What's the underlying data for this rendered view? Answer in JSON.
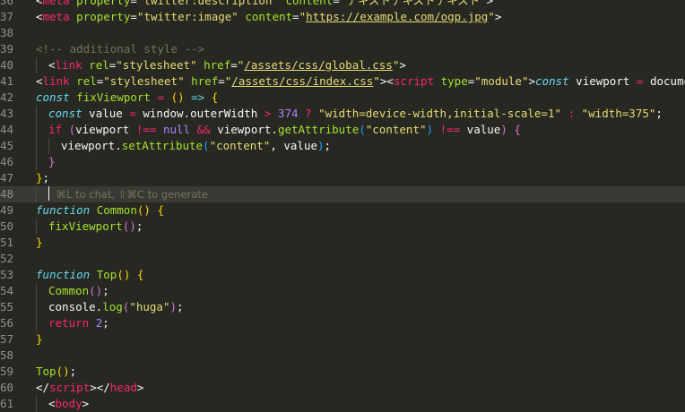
{
  "editor": {
    "lines": [
      {
        "num": "36",
        "parts": [
          {
            "t": "<",
            "c": "plain"
          },
          {
            "t": "meta",
            "c": "tag"
          },
          {
            "t": " ",
            "c": "plain"
          },
          {
            "t": "property",
            "c": "attr"
          },
          {
            "t": "=",
            "c": "plain"
          },
          {
            "t": "\"twitter:description\"",
            "c": "str"
          },
          {
            "t": " ",
            "c": "plain"
          },
          {
            "t": "content",
            "c": "attr"
          },
          {
            "t": "=",
            "c": "plain"
          },
          {
            "t": "\"テキストテキストテキスト\"",
            "c": "str"
          },
          {
            "t": ">",
            "c": "plain"
          }
        ]
      },
      {
        "num": "37",
        "parts": [
          {
            "t": "<",
            "c": "plain"
          },
          {
            "t": "meta",
            "c": "tag"
          },
          {
            "t": " ",
            "c": "plain"
          },
          {
            "t": "property",
            "c": "attr"
          },
          {
            "t": "=",
            "c": "plain"
          },
          {
            "t": "\"twitter:image\"",
            "c": "str"
          },
          {
            "t": " ",
            "c": "plain"
          },
          {
            "t": "content",
            "c": "attr"
          },
          {
            "t": "=",
            "c": "plain"
          },
          {
            "t": "\"",
            "c": "str"
          },
          {
            "t": "https://example.com/ogp.jpg",
            "c": "url"
          },
          {
            "t": "\"",
            "c": "str"
          },
          {
            "t": ">",
            "c": "plain"
          }
        ]
      },
      {
        "num": "38",
        "parts": []
      },
      {
        "num": "39",
        "parts": [
          {
            "t": "<!-- additional style -->",
            "c": "cmt"
          }
        ]
      },
      {
        "num": "40",
        "indent": 1,
        "parts": [
          {
            "t": "<",
            "c": "plain"
          },
          {
            "t": "link",
            "c": "tag"
          },
          {
            "t": " ",
            "c": "plain"
          },
          {
            "t": "rel",
            "c": "attr"
          },
          {
            "t": "=",
            "c": "plain"
          },
          {
            "t": "\"stylesheet\"",
            "c": "str"
          },
          {
            "t": " ",
            "c": "plain"
          },
          {
            "t": "href",
            "c": "attr"
          },
          {
            "t": "=",
            "c": "plain"
          },
          {
            "t": "\"",
            "c": "str"
          },
          {
            "t": "/assets/css/global.css",
            "c": "url"
          },
          {
            "t": "\"",
            "c": "str"
          },
          {
            "t": ">",
            "c": "plain"
          }
        ]
      },
      {
        "num": "41",
        "parts": [
          {
            "t": "<",
            "c": "plain"
          },
          {
            "t": "link",
            "c": "tag"
          },
          {
            "t": " ",
            "c": "plain"
          },
          {
            "t": "rel",
            "c": "attr"
          },
          {
            "t": "=",
            "c": "plain"
          },
          {
            "t": "\"stylesheet\"",
            "c": "str"
          },
          {
            "t": " ",
            "c": "plain"
          },
          {
            "t": "href",
            "c": "attr"
          },
          {
            "t": "=",
            "c": "plain"
          },
          {
            "t": "\"",
            "c": "str"
          },
          {
            "t": "/assets/css/index.css",
            "c": "url"
          },
          {
            "t": "\"",
            "c": "str"
          },
          {
            "t": "><",
            "c": "plain"
          },
          {
            "t": "script",
            "c": "tag"
          },
          {
            "t": " ",
            "c": "plain"
          },
          {
            "t": "type",
            "c": "attr"
          },
          {
            "t": "=",
            "c": "plain"
          },
          {
            "t": "\"module\"",
            "c": "str"
          },
          {
            "t": ">",
            "c": "plain"
          },
          {
            "t": "const",
            "c": "kw"
          },
          {
            "t": " viewport ",
            "c": "plain"
          },
          {
            "t": "=",
            "c": "op"
          },
          {
            "t": " document.",
            "c": "plain"
          }
        ]
      },
      {
        "num": "42",
        "parts": [
          {
            "t": "const",
            "c": "kw"
          },
          {
            "t": " ",
            "c": "plain"
          },
          {
            "t": "fixViewport",
            "c": "fn"
          },
          {
            "t": " ",
            "c": "plain"
          },
          {
            "t": "=",
            "c": "op"
          },
          {
            "t": " ",
            "c": "plain"
          },
          {
            "t": "()",
            "c": "brY"
          },
          {
            "t": " ",
            "c": "plain"
          },
          {
            "t": "=>",
            "c": "kw"
          },
          {
            "t": " ",
            "c": "plain"
          },
          {
            "t": "{",
            "c": "brY"
          }
        ]
      },
      {
        "num": "43",
        "indent": 1,
        "parts": [
          {
            "t": "const",
            "c": "kw"
          },
          {
            "t": " value ",
            "c": "plain"
          },
          {
            "t": "=",
            "c": "op"
          },
          {
            "t": " window.outerWidth ",
            "c": "plain"
          },
          {
            "t": ">",
            "c": "op"
          },
          {
            "t": " ",
            "c": "plain"
          },
          {
            "t": "374",
            "c": "num"
          },
          {
            "t": " ",
            "c": "plain"
          },
          {
            "t": "?",
            "c": "op"
          },
          {
            "t": " ",
            "c": "plain"
          },
          {
            "t": "\"width=device-width,initial-scale=1\"",
            "c": "str"
          },
          {
            "t": " ",
            "c": "plain"
          },
          {
            "t": ":",
            "c": "op"
          },
          {
            "t": " ",
            "c": "plain"
          },
          {
            "t": "\"width=375\"",
            "c": "str"
          },
          {
            "t": ";",
            "c": "plain"
          }
        ]
      },
      {
        "num": "44",
        "indent": 1,
        "parts": [
          {
            "t": "if",
            "c": "ctl"
          },
          {
            "t": " ",
            "c": "plain"
          },
          {
            "t": "(",
            "c": "brP"
          },
          {
            "t": "viewport ",
            "c": "plain"
          },
          {
            "t": "!==",
            "c": "op"
          },
          {
            "t": " ",
            "c": "plain"
          },
          {
            "t": "null",
            "c": "num"
          },
          {
            "t": " ",
            "c": "plain"
          },
          {
            "t": "&&",
            "c": "op"
          },
          {
            "t": " viewport.",
            "c": "plain"
          },
          {
            "t": "getAttribute",
            "c": "fn"
          },
          {
            "t": "(",
            "c": "brB"
          },
          {
            "t": "\"content\"",
            "c": "str"
          },
          {
            "t": ")",
            "c": "brB"
          },
          {
            "t": " ",
            "c": "plain"
          },
          {
            "t": "!==",
            "c": "op"
          },
          {
            "t": " value",
            "c": "plain"
          },
          {
            "t": ")",
            "c": "brP"
          },
          {
            "t": " ",
            "c": "plain"
          },
          {
            "t": "{",
            "c": "brP"
          }
        ]
      },
      {
        "num": "45",
        "indent": 2,
        "parts": [
          {
            "t": "viewport.",
            "c": "plain"
          },
          {
            "t": "setAttribute",
            "c": "fn"
          },
          {
            "t": "(",
            "c": "brB"
          },
          {
            "t": "\"content\"",
            "c": "str"
          },
          {
            "t": ", value",
            "c": "plain"
          },
          {
            "t": ")",
            "c": "brB"
          },
          {
            "t": ";",
            "c": "plain"
          }
        ]
      },
      {
        "num": "46",
        "indent": 1,
        "parts": [
          {
            "t": "}",
            "c": "brP"
          }
        ]
      },
      {
        "num": "47",
        "parts": [
          {
            "t": "}",
            "c": "brY"
          },
          {
            "t": ";",
            "c": "plain"
          }
        ]
      },
      {
        "num": "48",
        "active": true,
        "indent": 1,
        "cursor": true,
        "parts": [
          {
            "t": "⌘L to chat, ⇧⌘C to generate",
            "c": "hint"
          }
        ]
      },
      {
        "num": "49",
        "parts": [
          {
            "t": "function",
            "c": "kw"
          },
          {
            "t": " ",
            "c": "plain"
          },
          {
            "t": "Common",
            "c": "fn"
          },
          {
            "t": "()",
            "c": "brY"
          },
          {
            "t": " ",
            "c": "plain"
          },
          {
            "t": "{",
            "c": "brY"
          }
        ]
      },
      {
        "num": "50",
        "indent": 1,
        "parts": [
          {
            "t": "fixViewport",
            "c": "fn"
          },
          {
            "t": "()",
            "c": "brP"
          },
          {
            "t": ";",
            "c": "plain"
          }
        ]
      },
      {
        "num": "51",
        "parts": [
          {
            "t": "}",
            "c": "brY"
          }
        ]
      },
      {
        "num": "52",
        "parts": []
      },
      {
        "num": "53",
        "parts": [
          {
            "t": "function",
            "c": "kw"
          },
          {
            "t": " ",
            "c": "plain"
          },
          {
            "t": "Top",
            "c": "fn"
          },
          {
            "t": "()",
            "c": "brY"
          },
          {
            "t": " ",
            "c": "plain"
          },
          {
            "t": "{",
            "c": "brY"
          }
        ]
      },
      {
        "num": "54",
        "indent": 1,
        "parts": [
          {
            "t": "Common",
            "c": "fn"
          },
          {
            "t": "()",
            "c": "brP"
          },
          {
            "t": ";",
            "c": "plain"
          }
        ]
      },
      {
        "num": "55",
        "indent": 1,
        "parts": [
          {
            "t": "console.",
            "c": "plain"
          },
          {
            "t": "log",
            "c": "fn"
          },
          {
            "t": "(",
            "c": "brP"
          },
          {
            "t": "\"huga\"",
            "c": "str"
          },
          {
            "t": ")",
            "c": "brP"
          },
          {
            "t": ";",
            "c": "plain"
          }
        ]
      },
      {
        "num": "56",
        "indent": 1,
        "parts": [
          {
            "t": "return",
            "c": "ctl"
          },
          {
            "t": " ",
            "c": "plain"
          },
          {
            "t": "2",
            "c": "num"
          },
          {
            "t": ";",
            "c": "plain"
          }
        ]
      },
      {
        "num": "57",
        "parts": [
          {
            "t": "}",
            "c": "brY"
          }
        ]
      },
      {
        "num": "58",
        "parts": []
      },
      {
        "num": "59",
        "parts": [
          {
            "t": "Top",
            "c": "fn"
          },
          {
            "t": "()",
            "c": "brY"
          },
          {
            "t": ";",
            "c": "plain"
          }
        ]
      },
      {
        "num": "60",
        "parts": [
          {
            "t": "</",
            "c": "plain"
          },
          {
            "t": "script",
            "c": "tag"
          },
          {
            "t": "></",
            "c": "plain"
          },
          {
            "t": "head",
            "c": "tag"
          },
          {
            "t": ">",
            "c": "plain"
          }
        ]
      },
      {
        "num": "61",
        "indent": 1,
        "parts": [
          {
            "t": "<",
            "c": "plain"
          },
          {
            "t": "body",
            "c": "tag"
          },
          {
            "t": ">",
            "c": "plain"
          }
        ]
      }
    ]
  }
}
